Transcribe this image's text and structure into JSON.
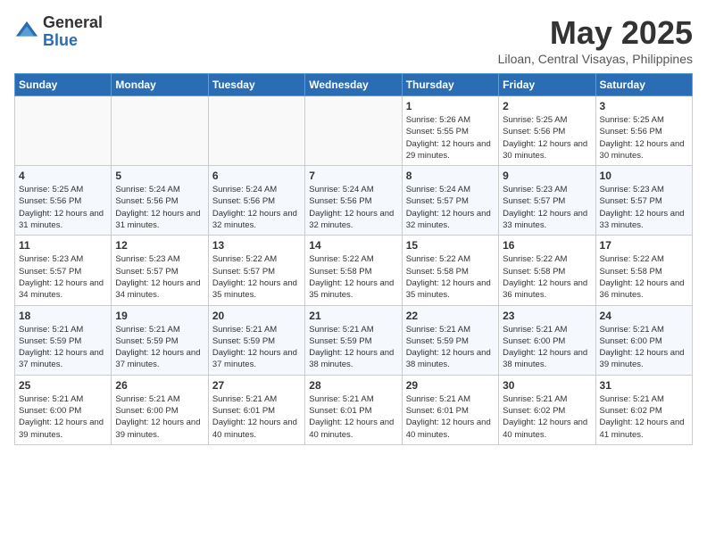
{
  "logo": {
    "general": "General",
    "blue": "Blue"
  },
  "header": {
    "month": "May 2025",
    "location": "Liloan, Central Visayas, Philippines"
  },
  "weekdays": [
    "Sunday",
    "Monday",
    "Tuesday",
    "Wednesday",
    "Thursday",
    "Friday",
    "Saturday"
  ],
  "weeks": [
    [
      {
        "day": "",
        "info": ""
      },
      {
        "day": "",
        "info": ""
      },
      {
        "day": "",
        "info": ""
      },
      {
        "day": "",
        "info": ""
      },
      {
        "day": "1",
        "info": "Sunrise: 5:26 AM\nSunset: 5:55 PM\nDaylight: 12 hours and 29 minutes."
      },
      {
        "day": "2",
        "info": "Sunrise: 5:25 AM\nSunset: 5:56 PM\nDaylight: 12 hours and 30 minutes."
      },
      {
        "day": "3",
        "info": "Sunrise: 5:25 AM\nSunset: 5:56 PM\nDaylight: 12 hours and 30 minutes."
      }
    ],
    [
      {
        "day": "4",
        "info": "Sunrise: 5:25 AM\nSunset: 5:56 PM\nDaylight: 12 hours and 31 minutes."
      },
      {
        "day": "5",
        "info": "Sunrise: 5:24 AM\nSunset: 5:56 PM\nDaylight: 12 hours and 31 minutes."
      },
      {
        "day": "6",
        "info": "Sunrise: 5:24 AM\nSunset: 5:56 PM\nDaylight: 12 hours and 32 minutes."
      },
      {
        "day": "7",
        "info": "Sunrise: 5:24 AM\nSunset: 5:56 PM\nDaylight: 12 hours and 32 minutes."
      },
      {
        "day": "8",
        "info": "Sunrise: 5:24 AM\nSunset: 5:57 PM\nDaylight: 12 hours and 32 minutes."
      },
      {
        "day": "9",
        "info": "Sunrise: 5:23 AM\nSunset: 5:57 PM\nDaylight: 12 hours and 33 minutes."
      },
      {
        "day": "10",
        "info": "Sunrise: 5:23 AM\nSunset: 5:57 PM\nDaylight: 12 hours and 33 minutes."
      }
    ],
    [
      {
        "day": "11",
        "info": "Sunrise: 5:23 AM\nSunset: 5:57 PM\nDaylight: 12 hours and 34 minutes."
      },
      {
        "day": "12",
        "info": "Sunrise: 5:23 AM\nSunset: 5:57 PM\nDaylight: 12 hours and 34 minutes."
      },
      {
        "day": "13",
        "info": "Sunrise: 5:22 AM\nSunset: 5:57 PM\nDaylight: 12 hours and 35 minutes."
      },
      {
        "day": "14",
        "info": "Sunrise: 5:22 AM\nSunset: 5:58 PM\nDaylight: 12 hours and 35 minutes."
      },
      {
        "day": "15",
        "info": "Sunrise: 5:22 AM\nSunset: 5:58 PM\nDaylight: 12 hours and 35 minutes."
      },
      {
        "day": "16",
        "info": "Sunrise: 5:22 AM\nSunset: 5:58 PM\nDaylight: 12 hours and 36 minutes."
      },
      {
        "day": "17",
        "info": "Sunrise: 5:22 AM\nSunset: 5:58 PM\nDaylight: 12 hours and 36 minutes."
      }
    ],
    [
      {
        "day": "18",
        "info": "Sunrise: 5:21 AM\nSunset: 5:59 PM\nDaylight: 12 hours and 37 minutes."
      },
      {
        "day": "19",
        "info": "Sunrise: 5:21 AM\nSunset: 5:59 PM\nDaylight: 12 hours and 37 minutes."
      },
      {
        "day": "20",
        "info": "Sunrise: 5:21 AM\nSunset: 5:59 PM\nDaylight: 12 hours and 37 minutes."
      },
      {
        "day": "21",
        "info": "Sunrise: 5:21 AM\nSunset: 5:59 PM\nDaylight: 12 hours and 38 minutes."
      },
      {
        "day": "22",
        "info": "Sunrise: 5:21 AM\nSunset: 5:59 PM\nDaylight: 12 hours and 38 minutes."
      },
      {
        "day": "23",
        "info": "Sunrise: 5:21 AM\nSunset: 6:00 PM\nDaylight: 12 hours and 38 minutes."
      },
      {
        "day": "24",
        "info": "Sunrise: 5:21 AM\nSunset: 6:00 PM\nDaylight: 12 hours and 39 minutes."
      }
    ],
    [
      {
        "day": "25",
        "info": "Sunrise: 5:21 AM\nSunset: 6:00 PM\nDaylight: 12 hours and 39 minutes."
      },
      {
        "day": "26",
        "info": "Sunrise: 5:21 AM\nSunset: 6:00 PM\nDaylight: 12 hours and 39 minutes."
      },
      {
        "day": "27",
        "info": "Sunrise: 5:21 AM\nSunset: 6:01 PM\nDaylight: 12 hours and 40 minutes."
      },
      {
        "day": "28",
        "info": "Sunrise: 5:21 AM\nSunset: 6:01 PM\nDaylight: 12 hours and 40 minutes."
      },
      {
        "day": "29",
        "info": "Sunrise: 5:21 AM\nSunset: 6:01 PM\nDaylight: 12 hours and 40 minutes."
      },
      {
        "day": "30",
        "info": "Sunrise: 5:21 AM\nSunset: 6:02 PM\nDaylight: 12 hours and 40 minutes."
      },
      {
        "day": "31",
        "info": "Sunrise: 5:21 AM\nSunset: 6:02 PM\nDaylight: 12 hours and 41 minutes."
      }
    ]
  ]
}
